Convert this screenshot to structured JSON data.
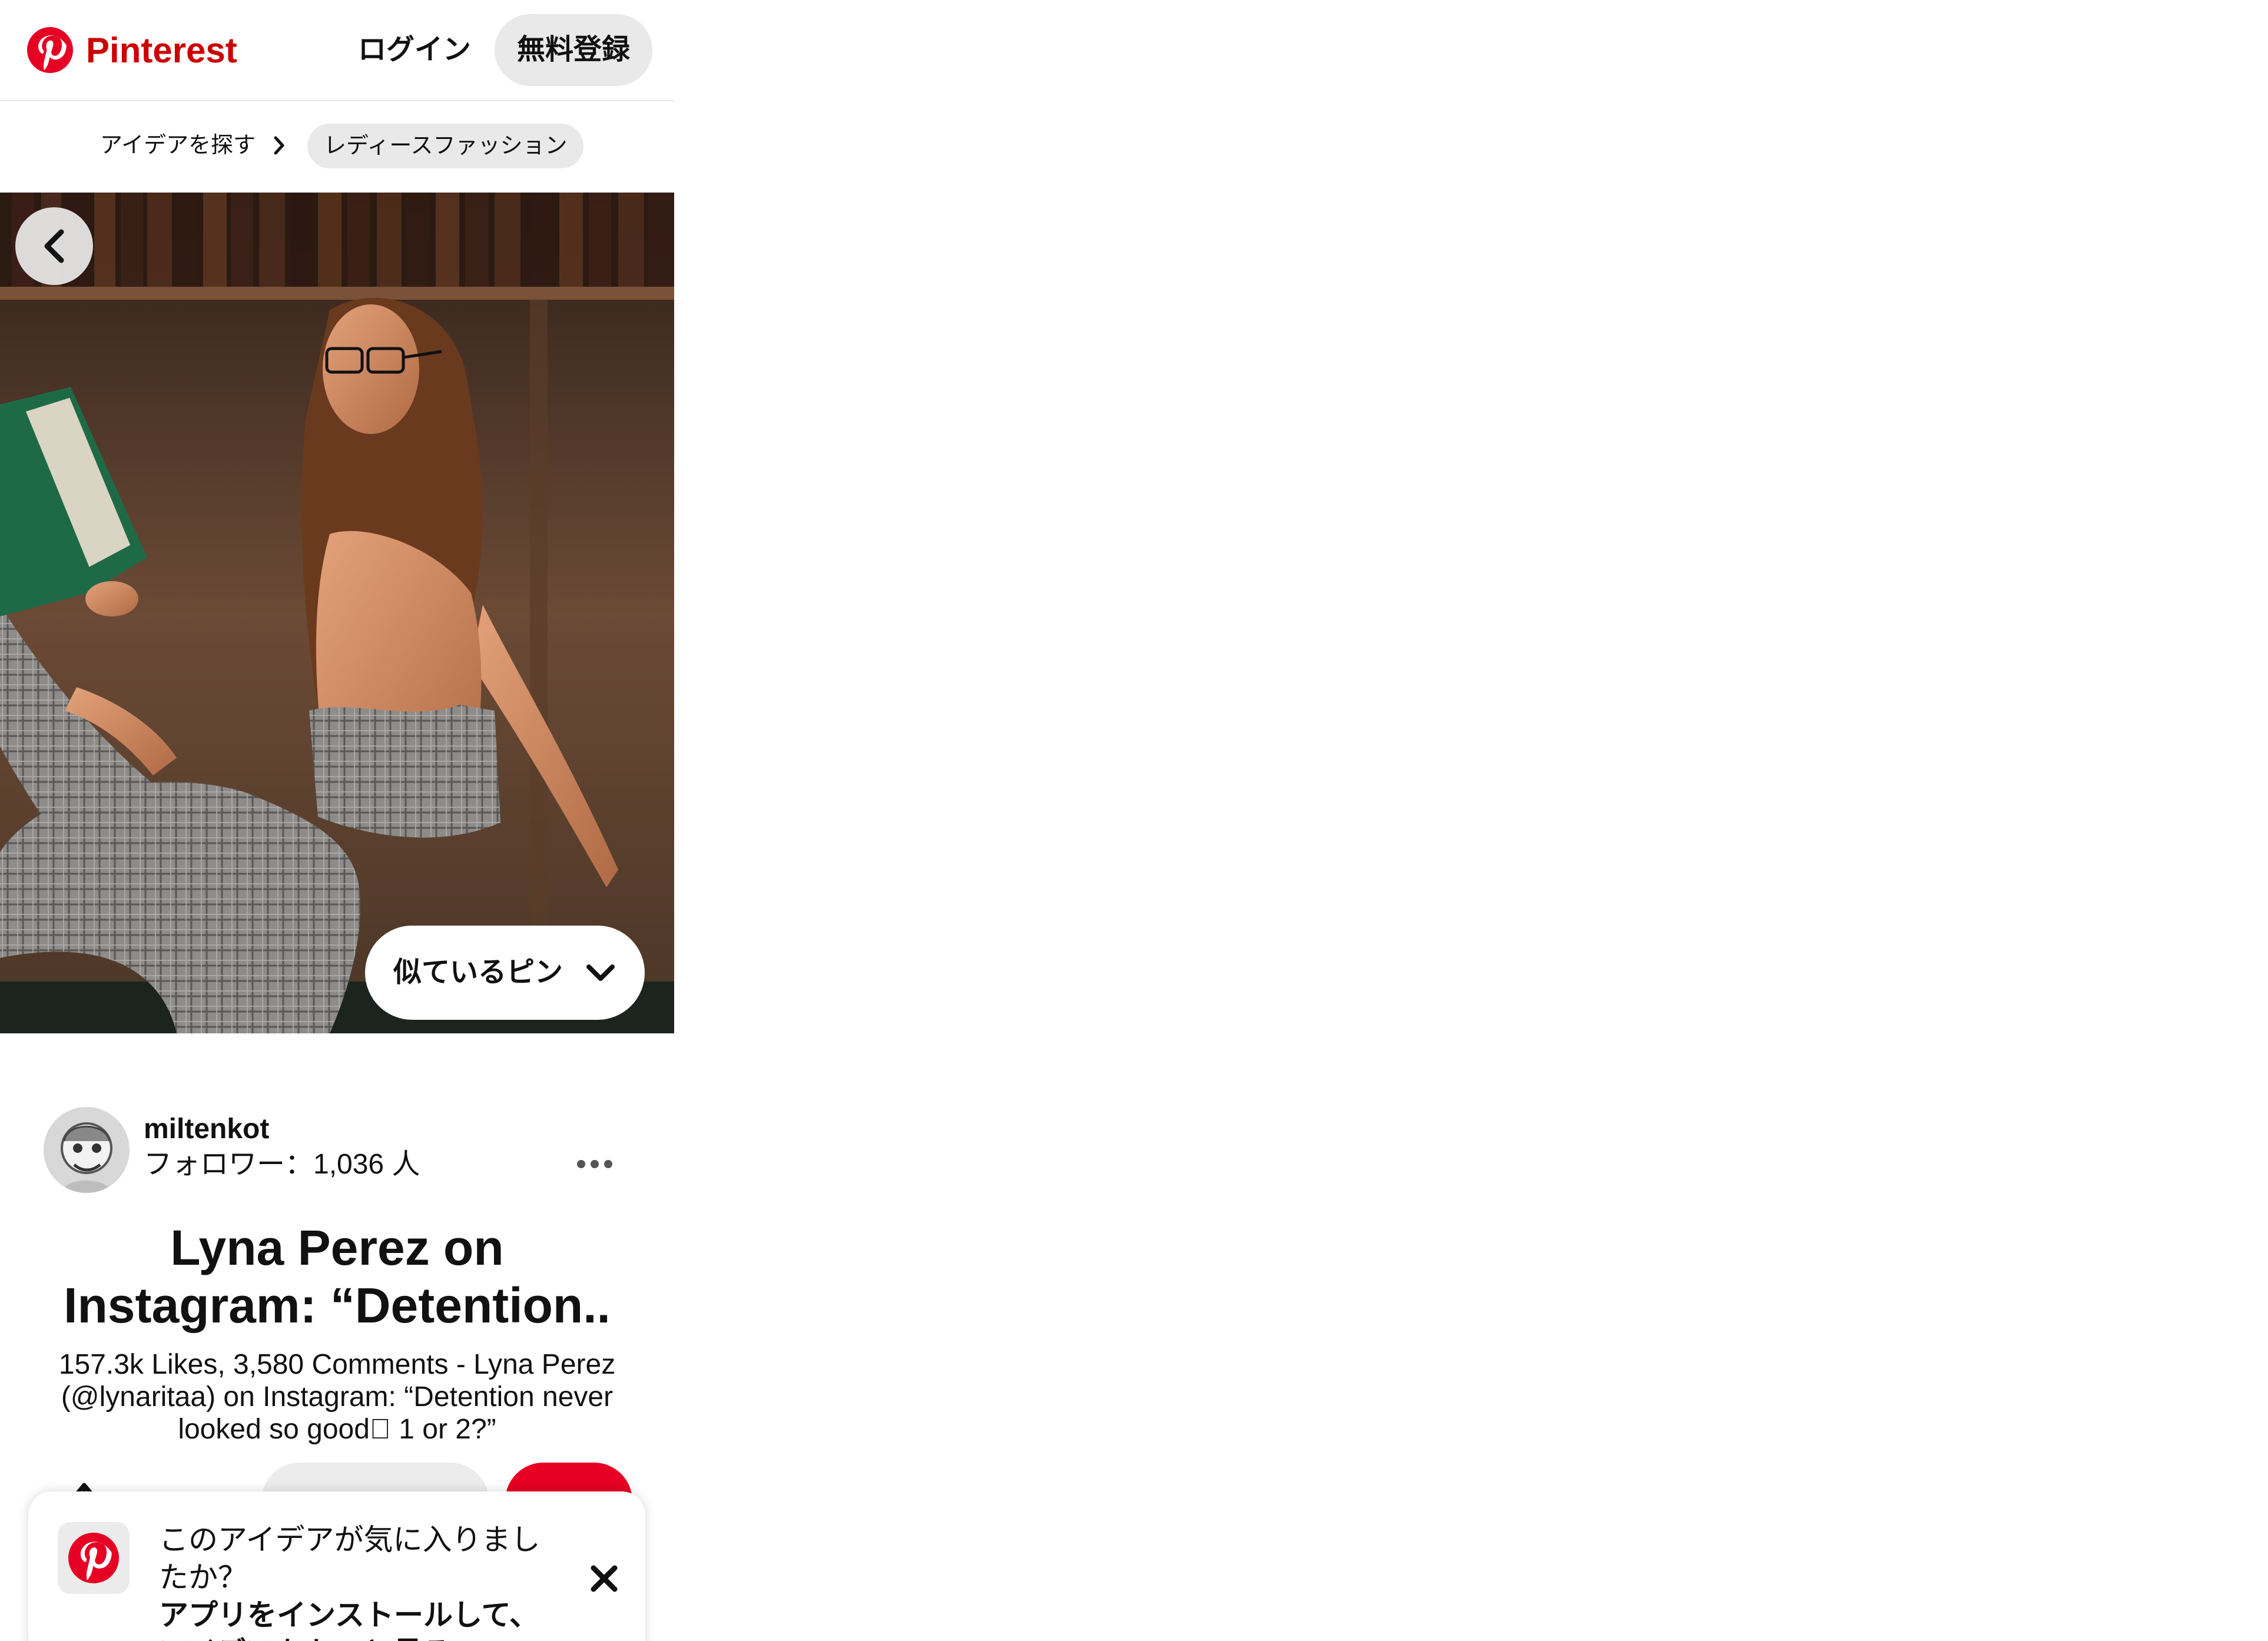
{
  "app": {
    "brand": "Pinterest",
    "brand_color": "#cc0000",
    "accent_color": "#e60023"
  },
  "header": {
    "login_label": "ログイン",
    "signup_label": "無料登録"
  },
  "breadcrumb": {
    "items": [
      "アイデアを探す",
      "レディースファッション"
    ]
  },
  "pin": {
    "similar_label": "似ているピン",
    "author": "miltenkot",
    "followers": "フォロワー：1,036 人",
    "title": "Lyna Perez on\nInstagram: “Detention..",
    "description": "157.3k Likes, 3,580 Comments - Lyna Perez (@lynaritaa) on Instagram: “Detention never looked so good\u0000 1 or 2?”"
  },
  "banner": {
    "line1": "このアイデアが気に入りましたか？",
    "line2": "アプリをインストールして、アイデアをもっと見る"
  },
  "icons": {
    "logo": "pinterest-logo-icon",
    "back": "chevron-left-icon",
    "similar": "chevron-down-icon",
    "more": "ellipsis-icon",
    "close": "close-icon",
    "share": "share-icon"
  }
}
